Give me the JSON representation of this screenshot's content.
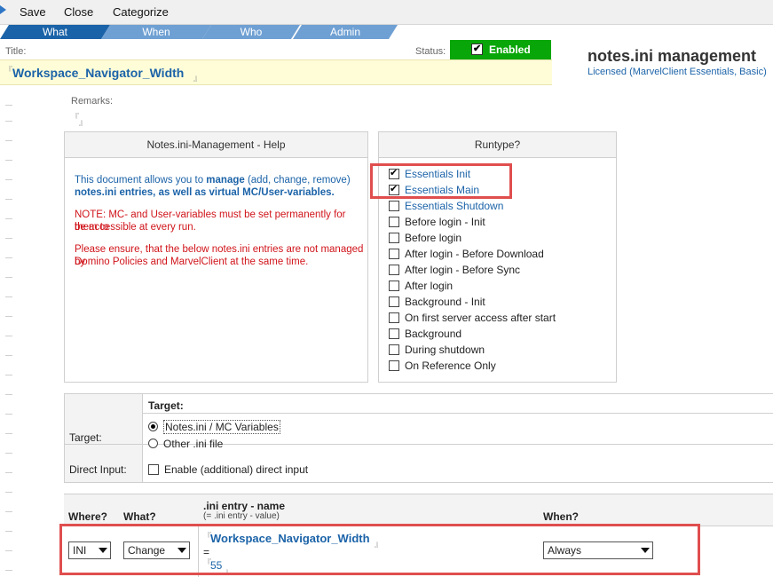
{
  "toolbar": {
    "save": "Save",
    "close": "Close",
    "categorize": "Categorize"
  },
  "tabs": [
    {
      "label": "What",
      "active": true
    },
    {
      "label": "When",
      "active": false
    },
    {
      "label": "Who",
      "active": false
    },
    {
      "label": "Admin",
      "active": false
    }
  ],
  "title": {
    "label": "Title:",
    "value": "Workspace_Navigator_Width"
  },
  "status": {
    "label": "Status:",
    "value": "Enabled",
    "checked": true
  },
  "brand": {
    "title": "notes.ini management",
    "subtitle": "Licensed (MarvelClient Essentials, Basic)"
  },
  "remarks": {
    "label": "Remarks:",
    "value": ""
  },
  "help": {
    "header": "Notes.ini-Management - Help",
    "p1_a": "This document allows you to ",
    "p1_b": "manage",
    "p1_c": " (add, change, remove)",
    "p1_d": "notes.ini entries, as well as virtual MC/User-variables.",
    "note1": "NOTE: MC- and User-variables must be set permanently for them to",
    "note2": "be accessible at every run.",
    "ens1": "Please ensure, that the below notes.ini entries are not managed by",
    "ens2": "Domino Policies and MarvelClient at the same time."
  },
  "runtype": {
    "header": "Runtype?",
    "items": [
      {
        "label": "Essentials Init",
        "checked": true
      },
      {
        "label": "Essentials Main",
        "checked": true
      },
      {
        "label": "Essentials Shutdown",
        "checked": false
      },
      {
        "label": "Before login - Init",
        "checked": false
      },
      {
        "label": "Before login",
        "checked": false
      },
      {
        "label": "After login - Before Download",
        "checked": false
      },
      {
        "label": "After login - Before Sync",
        "checked": false
      },
      {
        "label": "After login",
        "checked": false
      },
      {
        "label": "Background - Init",
        "checked": false
      },
      {
        "label": "On first server access after start",
        "checked": false
      },
      {
        "label": "Background",
        "checked": false
      },
      {
        "label": "During shutdown",
        "checked": false
      },
      {
        "label": "On Reference Only",
        "checked": false
      }
    ]
  },
  "target": {
    "header": "Target:",
    "row_label": "Target:",
    "options": [
      {
        "label": "Notes.ini / MC Variables",
        "selected": true
      },
      {
        "label": "Other .ini file",
        "selected": false
      }
    ],
    "direct_label": "Direct Input:",
    "direct_option": "Enable (additional) direct input"
  },
  "entries": {
    "where_header": "Where?",
    "what_header": "What?",
    "name_header": ".ini entry - name",
    "name_subheader": "(= .ini entry - value)",
    "when_header": "When?",
    "where_value": "INI",
    "what_value": "Change",
    "entry_name": "Workspace_Navigator_Width",
    "equals": "=",
    "entry_value": "55",
    "when_value": "Always"
  },
  "colors": {
    "accent_blue": "#1b63a8",
    "status_green": "#09a609",
    "highlight_red": "#e04e4e",
    "note_red": "#d0141a"
  }
}
